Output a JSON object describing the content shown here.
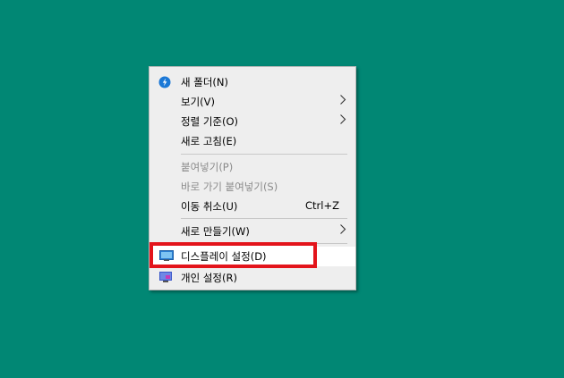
{
  "context_menu": {
    "items": [
      {
        "label": "새 폴더(N)"
      },
      {
        "label": "보기(V)"
      },
      {
        "label": "정렬 기준(O)"
      },
      {
        "label": "새로 고침(E)"
      },
      {
        "label": "붙여넣기(P)"
      },
      {
        "label": "바로 가기 붙여넣기(S)"
      },
      {
        "label": "이동 취소(U)",
        "shortcut": "Ctrl+Z"
      },
      {
        "label": "새로 만들기(W)"
      },
      {
        "label": "디스플레이 설정(D)"
      },
      {
        "label": "개인 설정(R)"
      }
    ]
  },
  "colors": {
    "desktop": "#018774",
    "annotation": "#e3141b"
  },
  "icons": {
    "new_folder": "lightning-badge-icon",
    "submenu": "chevron-right-icon",
    "display": "monitor-icon",
    "personalize": "personalize-icon"
  }
}
